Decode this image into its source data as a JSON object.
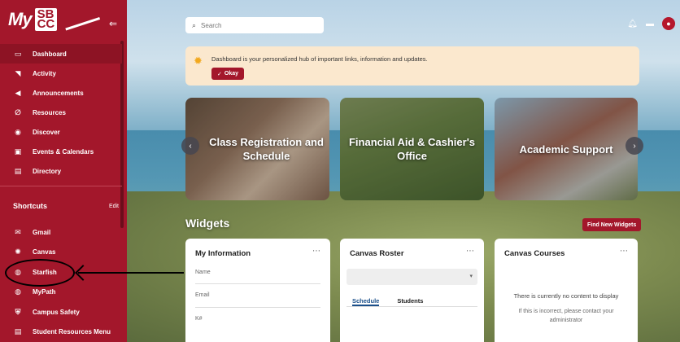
{
  "sidebar": {
    "logo_text": "My",
    "logo_mark_top": "SB",
    "logo_mark_bottom": "CC",
    "nav": [
      {
        "label": "Dashboard",
        "icon": "monitor-icon",
        "glyph": "▭",
        "active": true
      },
      {
        "label": "Activity",
        "icon": "rss-icon",
        "glyph": "◥"
      },
      {
        "label": "Announcements",
        "icon": "megaphone-icon",
        "glyph": "◀"
      },
      {
        "label": "Resources",
        "icon": "paperclip-icon",
        "glyph": "∅"
      },
      {
        "label": "Discover",
        "icon": "compass-icon",
        "glyph": "◉"
      },
      {
        "label": "Events & Calendars",
        "icon": "calendar-icon",
        "glyph": "▣"
      },
      {
        "label": "Directory",
        "icon": "address-book-icon",
        "glyph": "▤"
      }
    ],
    "shortcuts_title": "Shortcuts",
    "shortcuts_edit": "Edit",
    "shortcuts": [
      {
        "label": "Gmail",
        "icon": "mail-icon",
        "glyph": "✉"
      },
      {
        "label": "Canvas",
        "icon": "canvas-icon",
        "glyph": "✺"
      },
      {
        "label": "Starfish",
        "icon": "globe-icon",
        "glyph": "◍"
      },
      {
        "label": "MyPath",
        "icon": "globe-icon",
        "glyph": "◍"
      },
      {
        "label": "Campus Safety",
        "icon": "shield-icon",
        "glyph": "⛨"
      },
      {
        "label": "Student Resources Menu",
        "icon": "document-icon",
        "glyph": "▤"
      }
    ]
  },
  "topbar": {
    "search_placeholder": "Search"
  },
  "banner": {
    "message": "Dashboard is your personalized hub of important links, information and updates.",
    "okay_label": "Okay"
  },
  "carousel": {
    "cards": [
      {
        "label": "Class Registration and Schedule"
      },
      {
        "label": "Financial Aid & Cashier's Office"
      },
      {
        "label": "Academic Support"
      }
    ]
  },
  "widgets": {
    "title": "Widgets",
    "find_label": "Find New Widgets",
    "my_info": {
      "title": "My Information",
      "fields": [
        "Name",
        "Email",
        "K#"
      ]
    },
    "canvas_roster": {
      "title": "Canvas Roster",
      "tabs": [
        "Schedule",
        "Students"
      ]
    },
    "canvas_courses": {
      "title": "Canvas Courses",
      "empty": "There is currently no content to display",
      "empty_help": "If this is incorrect, please contact your administrator"
    }
  }
}
